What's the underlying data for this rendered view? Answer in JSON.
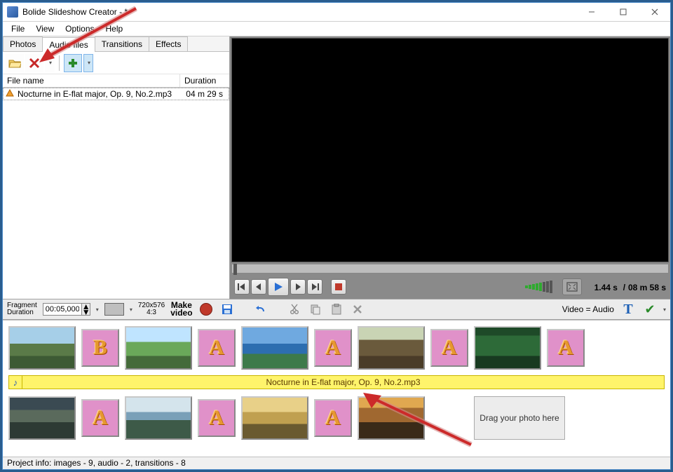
{
  "window": {
    "title": "Bolide Slideshow Creator - *"
  },
  "menu": {
    "items": [
      "File",
      "View",
      "Options",
      "Help"
    ]
  },
  "tabs": {
    "items": [
      "Photos",
      "Audio files",
      "Transitions",
      "Effects"
    ],
    "active": 1
  },
  "filelist": {
    "headers": {
      "name": "File name",
      "duration": "Duration"
    },
    "rows": [
      {
        "name": "Nocturne in E-flat major, Op. 9, No.2.mp3",
        "duration": "04 m 29 s"
      }
    ]
  },
  "player": {
    "time_current": "1.44 s",
    "time_sep": "/",
    "time_total": "08 m 58 s"
  },
  "mvbar": {
    "frag_label_1": "Fragment",
    "frag_label_2": "Duration",
    "frag_value": "00:05,000",
    "res_line1": "720x576",
    "res_line2": "4:3",
    "make_1": "Make",
    "make_2": "video",
    "va": "Video = Audio"
  },
  "timeline": {
    "audio_label": "Nocturne in E-flat major, Op. 9, No.2.mp3",
    "placeholder": "Drag your photo here",
    "trans_b": "B",
    "trans_a": "A"
  },
  "status": {
    "text": "Project info: images - 9, audio - 2, transitions - 8"
  }
}
